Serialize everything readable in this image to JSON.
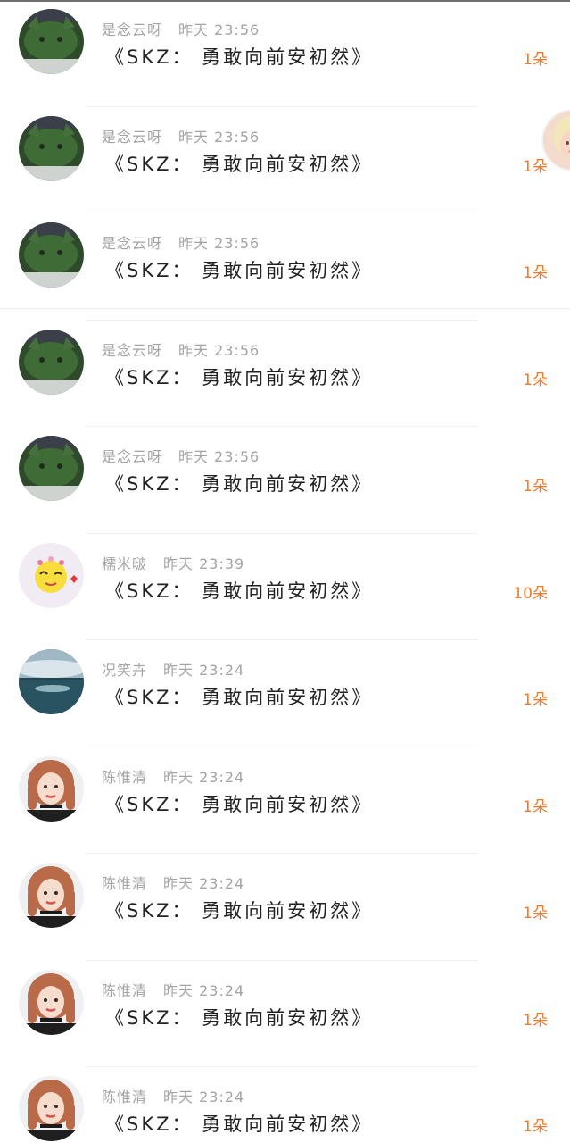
{
  "messages": [
    {
      "user": "是念云呀",
      "time": "昨天 23:56",
      "text": "《SKZ： 勇敢向前安初然》",
      "count": "1朵",
      "avatar": "green-cat"
    },
    {
      "user": "是念云呀",
      "time": "昨天 23:56",
      "text": "《SKZ： 勇敢向前安初然》",
      "count": "1朵",
      "avatar": "green-cat"
    },
    {
      "user": "是念云呀",
      "time": "昨天 23:56",
      "text": "《SKZ： 勇敢向前安初然》",
      "count": "1朵",
      "avatar": "green-cat"
    },
    {
      "user": "是念云呀",
      "time": "昨天 23:56",
      "text": "《SKZ： 勇敢向前安初然》",
      "count": "1朵",
      "avatar": "green-cat"
    },
    {
      "user": "是念云呀",
      "time": "昨天 23:56",
      "text": "《SKZ： 勇敢向前安初然》",
      "count": "1朵",
      "avatar": "green-cat"
    },
    {
      "user": "糯米啵",
      "time": "昨天 23:39",
      "text": "《SKZ： 勇敢向前安初然》",
      "count": "10朵",
      "avatar": "emoji-wink"
    },
    {
      "user": "况笑卉",
      "time": "昨天 23:24",
      "text": "《SKZ： 勇敢向前安初然》",
      "count": "1朵",
      "avatar": "ocean"
    },
    {
      "user": "陈惟清",
      "time": "昨天 23:24",
      "text": "《SKZ： 勇敢向前安初然》",
      "count": "1朵",
      "avatar": "girl"
    },
    {
      "user": "陈惟清",
      "time": "昨天 23:24",
      "text": "《SKZ： 勇敢向前安初然》",
      "count": "1朵",
      "avatar": "girl"
    },
    {
      "user": "陈惟清",
      "time": "昨天 23:24",
      "text": "《SKZ： 勇敢向前安初然》",
      "count": "1朵",
      "avatar": "girl"
    },
    {
      "user": "陈惟清",
      "time": "昨天 23:24",
      "text": "《SKZ： 勇敢向前安初然》",
      "count": "1朵",
      "avatar": "girl"
    }
  ],
  "floating_avatar": "blonde-person",
  "colors": {
    "count": "#f07b2c",
    "meta": "#a4a4a4",
    "text": "#222222"
  }
}
